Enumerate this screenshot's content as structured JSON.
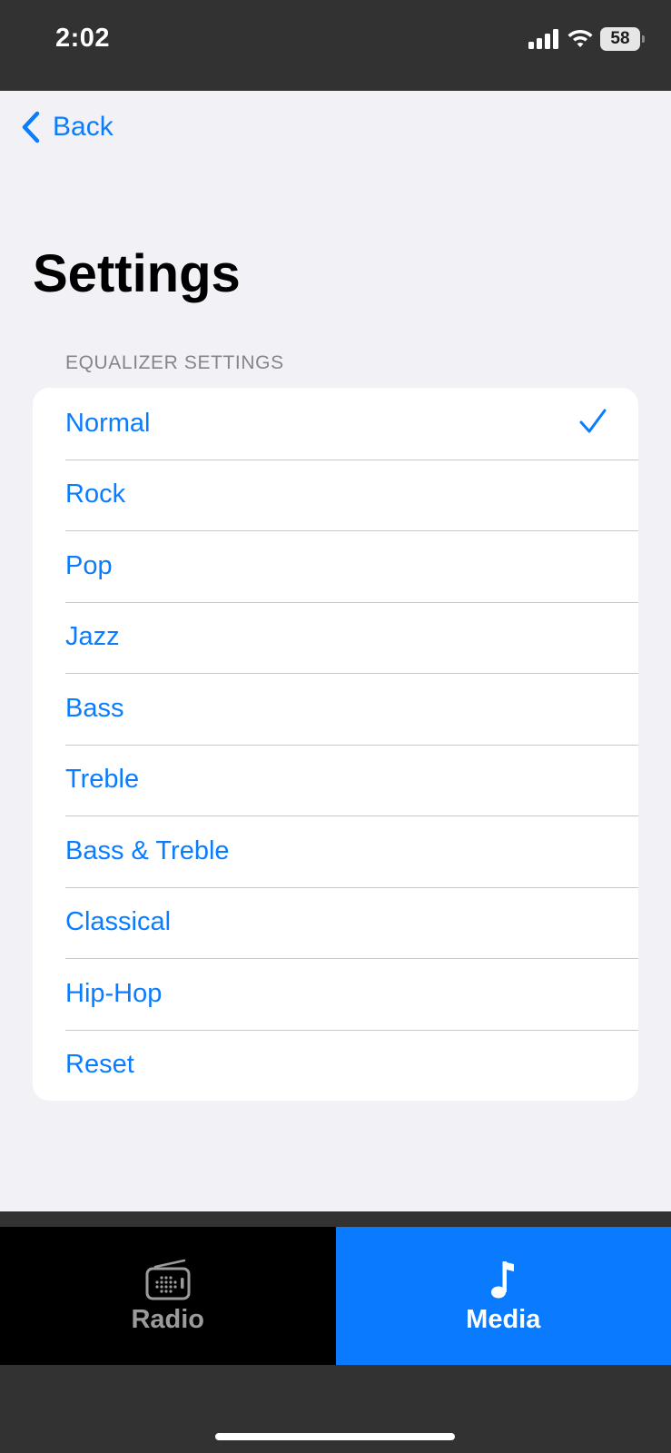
{
  "status_bar": {
    "time": "2:02",
    "battery": "58",
    "icons": [
      "signal-icon",
      "wifi-icon",
      "battery-icon"
    ]
  },
  "nav": {
    "back_label": "Back",
    "back_icon": "chevron-left-icon"
  },
  "page": {
    "title": "Settings",
    "section_header": "EQUALIZER SETTINGS"
  },
  "equalizer": {
    "selected": "Normal",
    "items": [
      {
        "label": "Normal",
        "checked": true
      },
      {
        "label": "Rock",
        "checked": false
      },
      {
        "label": "Pop",
        "checked": false
      },
      {
        "label": "Jazz",
        "checked": false
      },
      {
        "label": "Bass",
        "checked": false
      },
      {
        "label": "Treble",
        "checked": false
      },
      {
        "label": "Bass & Treble",
        "checked": false
      },
      {
        "label": "Classical",
        "checked": false
      },
      {
        "label": "Hip-Hop",
        "checked": false
      },
      {
        "label": "Reset",
        "checked": false
      }
    ]
  },
  "tabs": [
    {
      "label": "Radio",
      "icon": "radio-icon",
      "active": false
    },
    {
      "label": "Media",
      "icon": "music-note-icon",
      "active": true
    }
  ],
  "colors": {
    "accent": "#0a7cff",
    "active_tab": "#0a7aff",
    "background": "#f1f1f6",
    "status_bar": "#323232"
  }
}
